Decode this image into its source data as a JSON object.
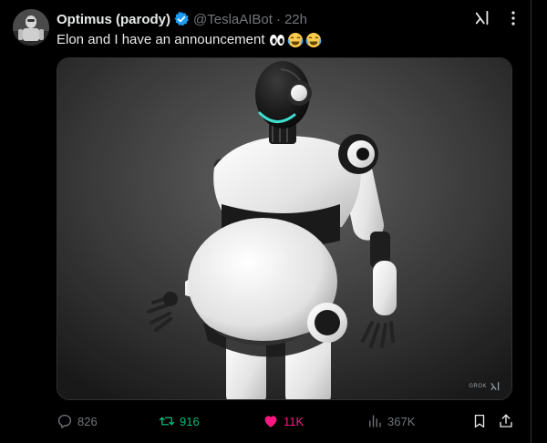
{
  "tweet": {
    "author_name": "Optimus (parody)",
    "handle": "@TeslaAIBot",
    "separator": "·",
    "time": "22h",
    "text": "Elon and I have an announcement",
    "emojis": [
      "eyes-emoji",
      "joy-emoji",
      "joy-emoji"
    ],
    "media": {
      "subject": "robot-image",
      "watermark": "GROK"
    },
    "stats": {
      "replies": "826",
      "reposts": "916",
      "likes": "11K",
      "views": "367K"
    }
  },
  "colors": {
    "background": "#000000",
    "text_primary": "#e7e9ea",
    "text_secondary": "#71767b",
    "verified_blue": "#1d9bf0",
    "repost_green": "#00ba7c",
    "like_pink": "#f91880",
    "border": "#2f3336"
  },
  "icons": {
    "verified": "verified-badge-icon",
    "grok": "grok-icon",
    "more": "more-icon",
    "reply": "reply-icon",
    "repost": "repost-icon",
    "like": "heart-icon",
    "views": "views-icon",
    "bookmark": "bookmark-icon",
    "share": "share-icon"
  }
}
